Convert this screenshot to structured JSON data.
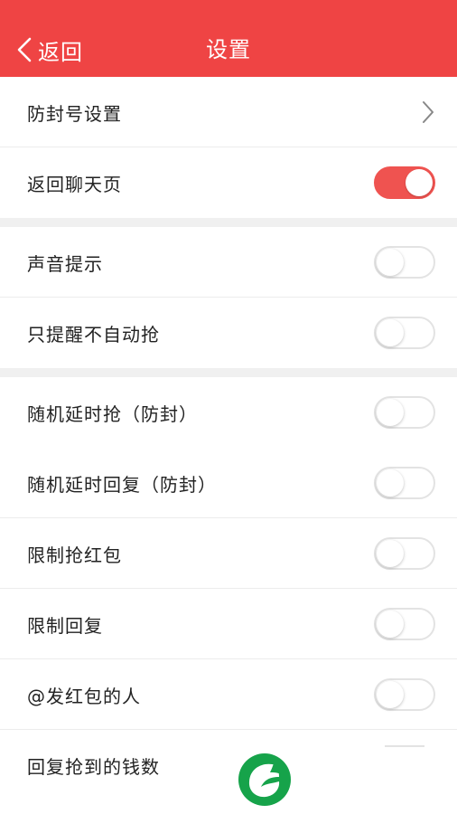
{
  "header": {
    "back_label": "返回",
    "title": "设置",
    "background": "#ef4444"
  },
  "items": [
    {
      "label": "防封号设置",
      "control": "chevron-right-icon"
    },
    {
      "label": "返回聊天页",
      "control": "toggle",
      "on": true
    },
    {
      "label": "声音提示",
      "control": "toggle",
      "on": false
    },
    {
      "label": "只提醒不自动抢",
      "control": "toggle",
      "on": false
    },
    {
      "label": "随机延时抢（防封）",
      "control": "toggle",
      "on": false
    },
    {
      "label": "随机延时回复（防封）",
      "control": "toggle",
      "on": false
    },
    {
      "label": "限制抢红包",
      "control": "toggle",
      "on": false
    },
    {
      "label": "限制回复",
      "control": "toggle",
      "on": false
    },
    {
      "label": "@发红包的人",
      "control": "toggle",
      "on": false
    },
    {
      "label": "回复抢到的钱数",
      "control": "toggle",
      "on": false
    }
  ],
  "colors": {
    "accent": "#ef5350",
    "toggle_off_border": "#e3e3e3",
    "section_gap": "#f0f0f0"
  },
  "watermark": {
    "icon": "leaf-logo-icon",
    "color": "#16a34a"
  }
}
